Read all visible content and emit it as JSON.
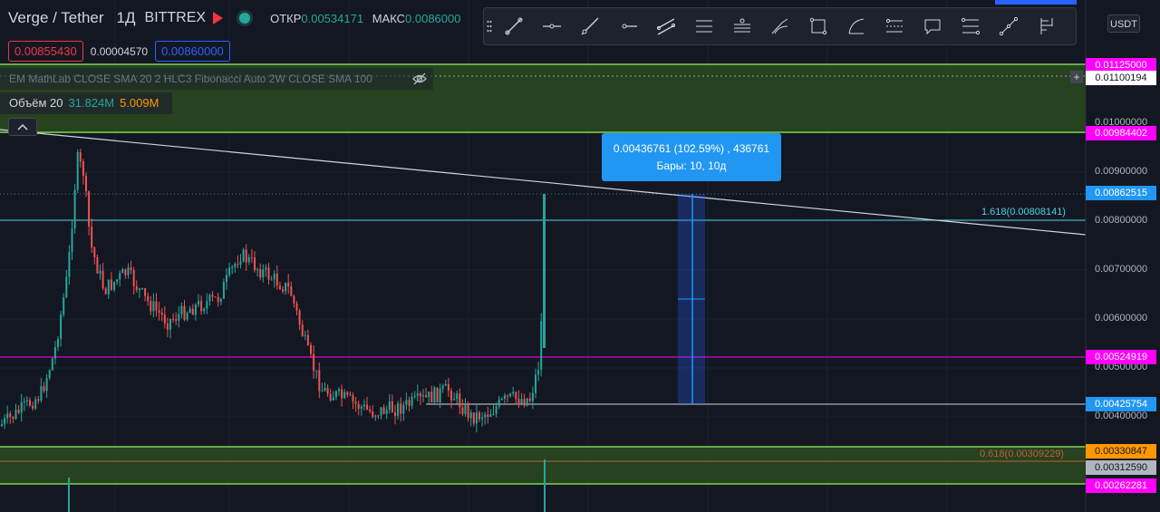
{
  "header": {
    "symbol": "Verge / Tether",
    "timeframe": "1Д",
    "exchange": "BITTREX",
    "open_label": "ОТКР",
    "open_value": "0.00534171",
    "high_label": "МАКС",
    "high_value": "0.0086000"
  },
  "prices": {
    "sell": "0.00855430",
    "spread": "0.00004570",
    "buy": "0.00860000"
  },
  "indicators_text": "EM MathLab CLOSE SMA 20 2 HLC3 Fibonacci Auto 2W CLOSE SMA 100",
  "volume": {
    "label": "Объём 20",
    "value1": "31.824M",
    "value2": "5.009M"
  },
  "currency_button": "USDT",
  "tooltip": {
    "line1": "0.00436761 (102.59%) , 436761",
    "line2": "Бары: 10, 10д"
  },
  "toolbar_icons": [
    "trend-line-icon",
    "horizontal-line-icon",
    "ray-icon",
    "horizontal-ray-icon",
    "parallel-channel-icon",
    "regression-trend-icon",
    "flat-top-bottom-icon",
    "pitchfork-icon",
    "rectangle-icon",
    "arc-icon",
    "long-position-icon",
    "callout-icon",
    "fib-retracement-icon",
    "fib-extension-icon",
    "pitchfan-icon"
  ],
  "price_scale": {
    "ticks": [
      "0.01000000",
      "0.00900000",
      "0.00800000",
      "0.00700000",
      "0.00600000",
      "0.00500000",
      "0.00400000"
    ],
    "labels": [
      {
        "text": "0.01125000",
        "bg": "#ff00ff",
        "fg": "#ffffff"
      },
      {
        "text": "0.01100194",
        "bg": "#ffffff",
        "fg": "#131722"
      },
      {
        "text": "0.00984402",
        "bg": "#ff00ff",
        "fg": "#ffffff"
      },
      {
        "text": "0.00862515",
        "bg": "#2196f3",
        "fg": "#ffffff"
      },
      {
        "text": "0.00524919",
        "bg": "#ff00ff",
        "fg": "#ffffff"
      },
      {
        "text": "0.00425754",
        "bg": "#2196f3",
        "fg": "#ffffff"
      },
      {
        "text": "0.00330847",
        "bg": "#ff9800",
        "fg": "#131722"
      },
      {
        "text": "0.00312590",
        "bg": "#b2b5be",
        "fg": "#131722"
      },
      {
        "text": "0.00262281",
        "bg": "#ff00ff",
        "fg": "#ffffff"
      }
    ]
  },
  "fib_labels": {
    "upper": "1.618(0.00808141)",
    "lower": "0.618(0.00309229)"
  },
  "colors": {
    "background": "#131722",
    "up": "#26a69a",
    "down": "#ef5350",
    "green_zone": "#2a4a1e",
    "magenta": "#ff00ff",
    "accent": "#2196f3"
  }
}
